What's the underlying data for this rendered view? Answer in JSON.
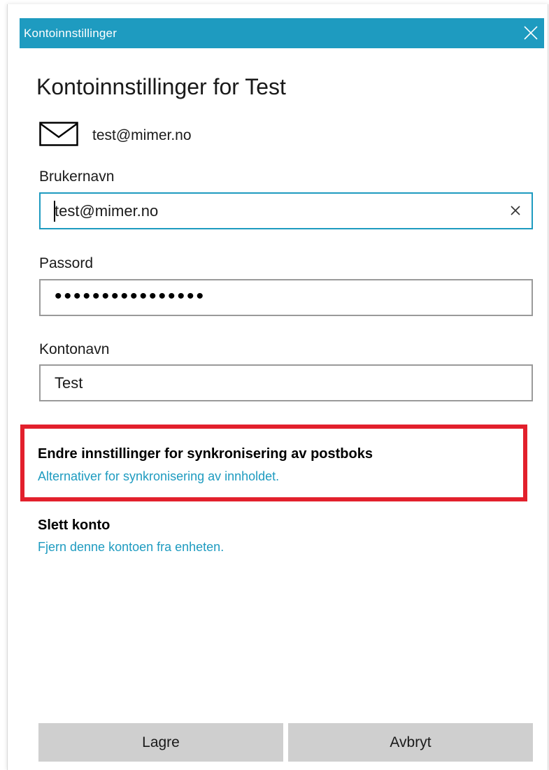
{
  "window": {
    "title": "Kontoinnstillinger",
    "accent_color": "#1e9bc0",
    "close_icon": "close-icon"
  },
  "page": {
    "heading": "Kontoinnstillinger for Test"
  },
  "account": {
    "icon": "mail-icon",
    "email": "test@mimer.no"
  },
  "form": {
    "username": {
      "label": "Brukernavn",
      "value": "test@mimer.no",
      "clear_icon": "clear-icon"
    },
    "password": {
      "label": "Passord",
      "masked_value": "••••••••••••••••"
    },
    "account_name": {
      "label": "Kontonavn",
      "value": "Test"
    }
  },
  "sync_settings": {
    "title": "Endre innstillinger for synkronisering av postboks",
    "link": "Alternativer for synkronisering av innholdet.",
    "highlight_color": "#e2202c"
  },
  "delete_account": {
    "title": "Slett konto",
    "link": "Fjern denne kontoen fra enheten."
  },
  "buttons": {
    "save": "Lagre",
    "cancel": "Avbryt"
  }
}
